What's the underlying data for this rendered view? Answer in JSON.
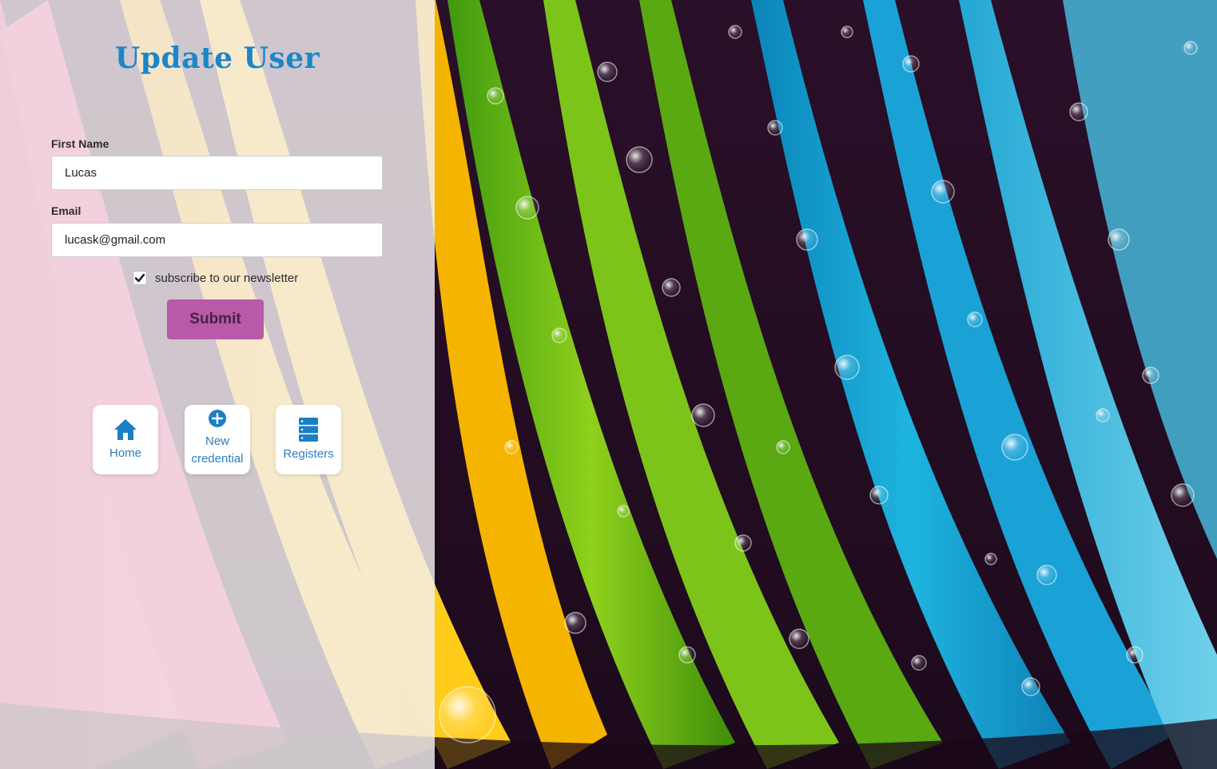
{
  "form": {
    "title": "Update User",
    "first_name_label": "First Name",
    "first_name_value": "Lucas",
    "email_label": "Email",
    "email_value": "lucask@gmail.com",
    "newsletter_label": "subscribe to our newsletter",
    "newsletter_checked": true,
    "submit_label": "Submit"
  },
  "nav": {
    "home_label": "Home",
    "home_icon": "home-icon",
    "new_credential_label_1": "New",
    "new_credential_label_2": "credential",
    "new_credential_icon": "plus-circle-icon",
    "registers_label": "Registers",
    "registers_icon": "server-icon"
  },
  "colors": {
    "title": "#1b86c9",
    "submit_bg": "#b85aa8",
    "nav_text": "#2b7fc2"
  }
}
